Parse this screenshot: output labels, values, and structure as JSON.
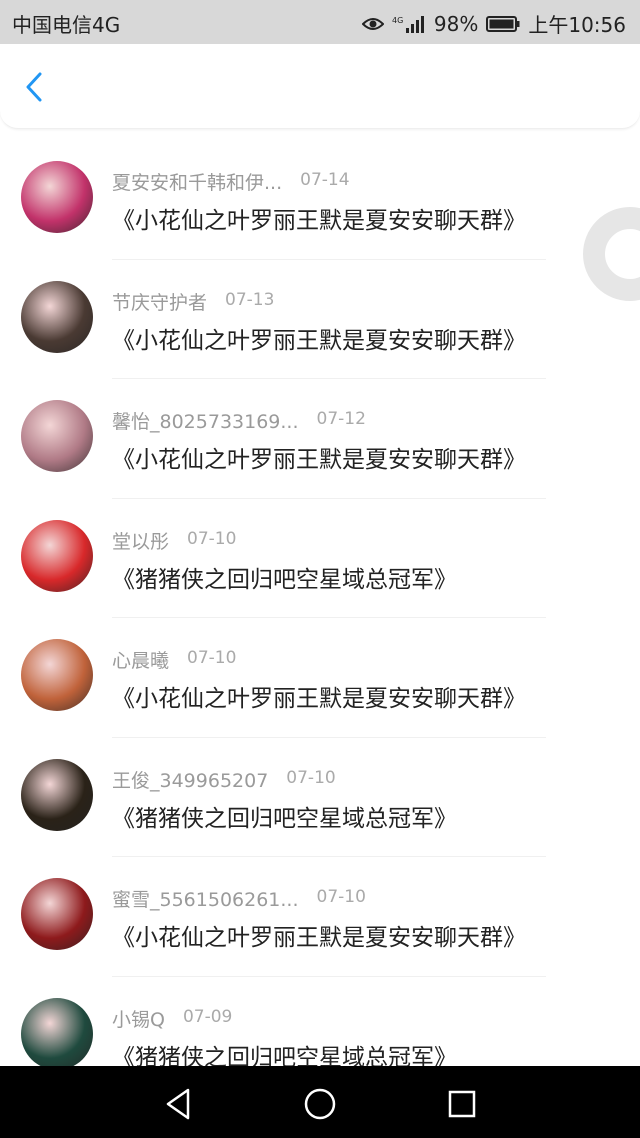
{
  "status_bar": {
    "carrier": "中国电信4G",
    "network": "4G",
    "battery": "98%",
    "time": "上午10:56"
  },
  "header": {
    "back_icon": "chevron-left-icon"
  },
  "rows": [
    {
      "name": "夏安安和千韩和伊...",
      "date": "07-14",
      "title": "《小花仙之叶罗丽王默是夏安安聊天群》",
      "avatar": "#c2326a"
    },
    {
      "name": "节庆守护者",
      "date": "07-13",
      "title": "《小花仙之叶罗丽王默是夏安安聊天群》",
      "avatar": "#4a3a33"
    },
    {
      "name": "馨怡_8025733169...",
      "date": "07-12",
      "title": "《小花仙之叶罗丽王默是夏安安聊天群》",
      "avatar": "#b07a86"
    },
    {
      "name": "堂以彤",
      "date": "07-10",
      "title": "《猪猪侠之回归吧空星域总冠军》",
      "avatar": "#d8282a"
    },
    {
      "name": "心晨曦",
      "date": "07-10",
      "title": "《小花仙之叶罗丽王默是夏安安聊天群》",
      "avatar": "#c0623a"
    },
    {
      "name": "王俊_349965207",
      "date": "07-10",
      "title": "《猪猪侠之回归吧空星域总冠军》",
      "avatar": "#2a2218"
    },
    {
      "name": "蜜雪_5561506261...",
      "date": "07-10",
      "title": "《小花仙之叶罗丽王默是夏安安聊天群》",
      "avatar": "#8e1a1c"
    },
    {
      "name": "小锡Q",
      "date": "07-09",
      "title": "《猪猪侠之回归吧空星域总冠军》",
      "avatar": "#1f4a3e"
    }
  ]
}
